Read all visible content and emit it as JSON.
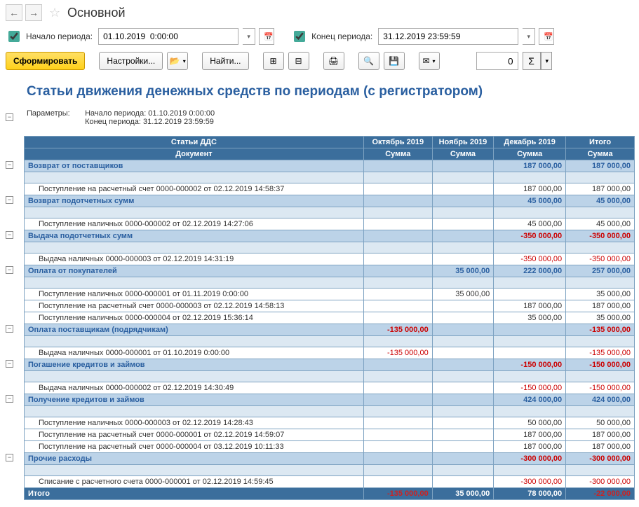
{
  "title": "Основной",
  "params": {
    "start_label": "Начало периода:",
    "start_value": "01.10.2019  0:00:00",
    "end_label": "Конец периода:",
    "end_value": "31.12.2019 23:59:59"
  },
  "toolbar": {
    "run": "Сформировать",
    "settings": "Настройки...",
    "find": "Найти...",
    "num_value": "0"
  },
  "report": {
    "title": "Статьи движения денежных средств по периодам (с регистратором)",
    "params_label": "Параметры:",
    "param_lines": [
      "Начало периода: 01.10.2019 0:00:00",
      "Конец периода: 31.12.2019 23:59:59"
    ],
    "cols": {
      "main": "Статьи ДДС",
      "main2": "Документ",
      "p1": "Октябрь 2019",
      "p2": "Ноябрь 2019",
      "p3": "Декабрь 2019",
      "pt": "Итого",
      "sum": "Сумма"
    },
    "rows": [
      {
        "type": "grp",
        "label": "Возврат от поставщиков",
        "v": [
          "",
          "",
          "187 000,00",
          "187 000,00"
        ]
      },
      {
        "type": "grp2",
        "label": "",
        "v": [
          "",
          "",
          "",
          ""
        ]
      },
      {
        "type": "det",
        "label": "Поступление на расчетный счет 0000-000002 от 02.12.2019 14:58:37",
        "v": [
          "",
          "",
          "187 000,00",
          "187 000,00"
        ]
      },
      {
        "type": "grp",
        "label": "Возврат подотчетных сумм",
        "v": [
          "",
          "",
          "45 000,00",
          "45 000,00"
        ]
      },
      {
        "type": "grp2",
        "label": "",
        "v": [
          "",
          "",
          "",
          ""
        ]
      },
      {
        "type": "det",
        "label": "Поступление наличных 0000-000002 от 02.12.2019 14:27:06",
        "v": [
          "",
          "",
          "45 000,00",
          "45 000,00"
        ]
      },
      {
        "type": "grp",
        "label": "Выдача подотчетных сумм",
        "v": [
          "",
          "",
          "-350 000,00",
          "-350 000,00"
        ],
        "neg": [
          false,
          false,
          true,
          true
        ]
      },
      {
        "type": "grp2",
        "label": "",
        "v": [
          "",
          "",
          "",
          ""
        ]
      },
      {
        "type": "det",
        "label": "Выдача наличных 0000-000003 от 02.12.2019 14:31:19",
        "v": [
          "",
          "",
          "-350 000,00",
          "-350 000,00"
        ],
        "neg": [
          false,
          false,
          true,
          true
        ]
      },
      {
        "type": "grp",
        "label": "Оплата от покупателей",
        "v": [
          "",
          "35 000,00",
          "222 000,00",
          "257 000,00"
        ]
      },
      {
        "type": "grp2",
        "label": "",
        "v": [
          "",
          "",
          "",
          ""
        ]
      },
      {
        "type": "det",
        "label": "Поступление наличных 0000-000001 от 01.11.2019 0:00:00",
        "v": [
          "",
          "35 000,00",
          "",
          "35 000,00"
        ]
      },
      {
        "type": "det",
        "label": "Поступление на расчетный счет 0000-000003 от 02.12.2019 14:58:13",
        "v": [
          "",
          "",
          "187 000,00",
          "187 000,00"
        ]
      },
      {
        "type": "det",
        "label": "Поступление наличных 0000-000004 от 02.12.2019 15:36:14",
        "v": [
          "",
          "",
          "35 000,00",
          "35 000,00"
        ]
      },
      {
        "type": "grp",
        "label": "Оплата поставщикам (подрядчикам)",
        "v": [
          "-135 000,00",
          "",
          "",
          "-135 000,00"
        ],
        "neg": [
          true,
          false,
          false,
          true
        ]
      },
      {
        "type": "grp2",
        "label": "",
        "v": [
          "",
          "",
          "",
          ""
        ]
      },
      {
        "type": "det",
        "label": "Выдача наличных 0000-000001 от 01.10.2019 0:00:00",
        "v": [
          "-135 000,00",
          "",
          "",
          "-135 000,00"
        ],
        "neg": [
          true,
          false,
          false,
          true
        ]
      },
      {
        "type": "grp",
        "label": "Погашение кредитов и займов",
        "v": [
          "",
          "",
          "-150 000,00",
          "-150 000,00"
        ],
        "neg": [
          false,
          false,
          true,
          true
        ]
      },
      {
        "type": "grp2",
        "label": "",
        "v": [
          "",
          "",
          "",
          ""
        ]
      },
      {
        "type": "det",
        "label": "Выдача наличных 0000-000002 от 02.12.2019 14:30:49",
        "v": [
          "",
          "",
          "-150 000,00",
          "-150 000,00"
        ],
        "neg": [
          false,
          false,
          true,
          true
        ]
      },
      {
        "type": "grp",
        "label": "Получение кредитов и займов",
        "v": [
          "",
          "",
          "424 000,00",
          "424 000,00"
        ]
      },
      {
        "type": "grp2",
        "label": "",
        "v": [
          "",
          "",
          "",
          ""
        ]
      },
      {
        "type": "det",
        "label": "Поступление наличных 0000-000003 от 02.12.2019 14:28:43",
        "v": [
          "",
          "",
          "50 000,00",
          "50 000,00"
        ]
      },
      {
        "type": "det",
        "label": "Поступление на расчетный счет 0000-000001 от 02.12.2019 14:59:07",
        "v": [
          "",
          "",
          "187 000,00",
          "187 000,00"
        ]
      },
      {
        "type": "det",
        "label": "Поступление на расчетный счет 0000-000004 от 03.12.2019 10:11:33",
        "v": [
          "",
          "",
          "187 000,00",
          "187 000,00"
        ]
      },
      {
        "type": "grp",
        "label": "Прочие расходы",
        "v": [
          "",
          "",
          "-300 000,00",
          "-300 000,00"
        ],
        "neg": [
          false,
          false,
          true,
          true
        ]
      },
      {
        "type": "grp2",
        "label": "",
        "v": [
          "",
          "",
          "",
          ""
        ]
      },
      {
        "type": "det",
        "label": "Списание с расчетного счета 0000-000001 от 02.12.2019 14:59:45",
        "v": [
          "",
          "",
          "-300 000,00",
          "-300 000,00"
        ],
        "neg": [
          false,
          false,
          true,
          true
        ]
      }
    ],
    "total": {
      "label": "Итого",
      "v": [
        "-135 000,00",
        "35 000,00",
        "78 000,00",
        "-22 000,00"
      ],
      "neg": [
        true,
        false,
        false,
        true
      ]
    }
  }
}
